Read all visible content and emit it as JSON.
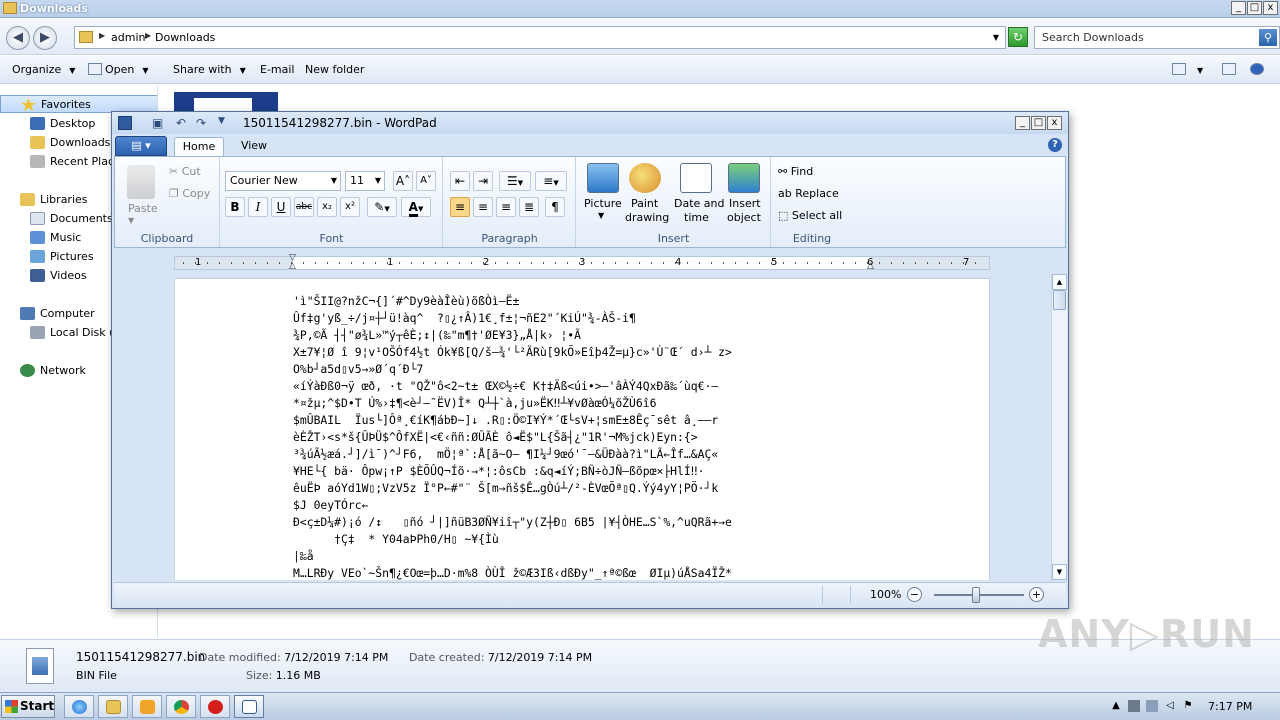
{
  "explorer": {
    "title": "Downloads",
    "caption_buttons": [
      "_",
      "□",
      "x"
    ],
    "breadcrumb": [
      "admin",
      "Downloads"
    ],
    "search_placeholder": "Search Downloads",
    "toolbar": {
      "organize": "Organize",
      "open": "Open",
      "share_with": "Share with",
      "email": "E-mail",
      "new_folder": "New folder"
    },
    "nav": {
      "favorites": "Favorites",
      "desktop": "Desktop",
      "downloads": "Downloads",
      "recent_places": "Recent Places",
      "libraries": "Libraries",
      "documents": "Documents",
      "music": "Music",
      "pictures": "Pictures",
      "videos": "Videos",
      "computer": "Computer",
      "local_disk": "Local Disk (C:)",
      "network": "Network"
    },
    "details": {
      "filename": "15011541298277.bin",
      "date_modified_label": "Date modified:",
      "date_modified": "7/12/2019 7:14 PM",
      "date_created_label": "Date created:",
      "date_created": "7/12/2019 7:14 PM",
      "type": "BIN File",
      "size_label": "Size:",
      "size": "1.16 MB"
    }
  },
  "wordpad": {
    "title": "15011541298277.bin - WordPad",
    "tabs": {
      "home": "Home",
      "view": "View"
    },
    "clipboard": {
      "paste": "Paste",
      "cut": "Cut",
      "copy": "Copy",
      "group": "Clipboard"
    },
    "font": {
      "name": "Courier New",
      "size": "11",
      "group": "Font"
    },
    "paragraph": {
      "group": "Paragraph"
    },
    "insert": {
      "picture": "Picture",
      "paint_drawing_1": "Paint",
      "paint_drawing_2": "drawing",
      "date_time_1": "Date and",
      "date_time_2": "time",
      "insert_object_1": "Insert",
      "insert_object_2": "object",
      "group": "Insert"
    },
    "editing": {
      "find": "Find",
      "replace": "Replace",
      "select_all": "Select all",
      "group": "Editing"
    },
    "ruler_numbers": [
      "1",
      "1",
      "2",
      "3",
      "4",
      "5",
      "6",
      "7"
    ],
    "document_lines": [
      "'ì\"ŠII@?nžC¬{]´#^Dy9èàÎèù)õßÒì–Ë±",
      "Ûf‡g'yß_÷/j¤┼┘ü!àq^  ?▯¿↑Â)1€¸f±¦¬ñE2\"´KiÚ\"¾-ÀŠ-i¶",
      "¾P,©Ã ┤┤\"ø¾L»™ý┬êÈ;↕|(‰\"m¶†'ØE¥3}„Å|k› ¦•Ã",
      "X±7¥¦Ø î 9¦v¹OŠÓf4½t Ók¥ß[Q/š—¾'└²ÃRù[9kÕ»Eîþ4Ž=µ}c»'Ù¨Œ´ d›┴ z>",
      "O%b┘a5d▯v5→»Ø´q´Ð└7",
      "«íÝàÐß0¬ÿ œð, ·t \"QŽ\"ô<2~t± ŒX©½÷€ K†‡Äß<úi•>—'âÀÝ4QxÐã‰´ùq€·–",
      "*¤žµ;^$D•T Ú%›‡¶<è┘–˜ËV)Î* Q┴┼`à,ju»ËK‼┴¥vØàœÓ¼õŽÙ6î6",
      "$mÛBAIL  Ïus└]Ôª¸€íK¶ábÐ~]↓ .R▯:Ö©I¥Ý*´Œ└sV+¦smE±8Êç¯sêt â¸——r",
      "èÈŽT›<s*š{ÛÞÜ$^ÔfXË|<€‹ññ:ØÛÃÈ ô◄Ë$\"L{Šã┤¿\"1R'¬M%jck)Eyn:{>",
      "³¾úÃ½æá.┘]/ì¯)^┘F6,  mÖ¦ª`:Å[ã~O— ¶I¼┘9œó'¯–&ÜÐàà?ì\"LÃ←Îf…&AÇ«",
      "¥HE└{ bä· Ôpw¡↑P $ÈÕÛQ¬Íõ·→*¦:ôsCb :&q◄íÝ;BÑ÷òJÑ—ßõpœ×├HlÍ‼·",
      "êuËÞ aóYd1W▯;VzV5z Ï°P←#\"¨ Š[m→ñš$Ê…gÒú┴/²-ÈVœÕª▯Q.Ýý4yY¦PÕ·┘k",
      "$J 0eyTÓrc←",
      "Ð<ç±D¼#)¡ó /↕   ▯ñó ┘|]ñüB3ØÑ¥iî┬\"y(Z┼Ð▯ 6B5 |¥┤ÒHE…S`%,^uQRã+→e",
      "      †Ç‡  * Y04aÞPh0/H▯ ~¥{Ìù",
      "|‰å",
      "M…LRÐy VEo`~Šn¶¿€Oœ=þ…D·m%8 ÒÙÎ ž©Æ3Iß‹dßÐy\"_↑ª©ßœ  ØIµ)úÅSa4ÏŽ*"
    ],
    "zoom": "100%"
  },
  "watermark": "ANY▷RUN",
  "taskbar": {
    "start": "Start",
    "clock": "7:17 PM"
  }
}
